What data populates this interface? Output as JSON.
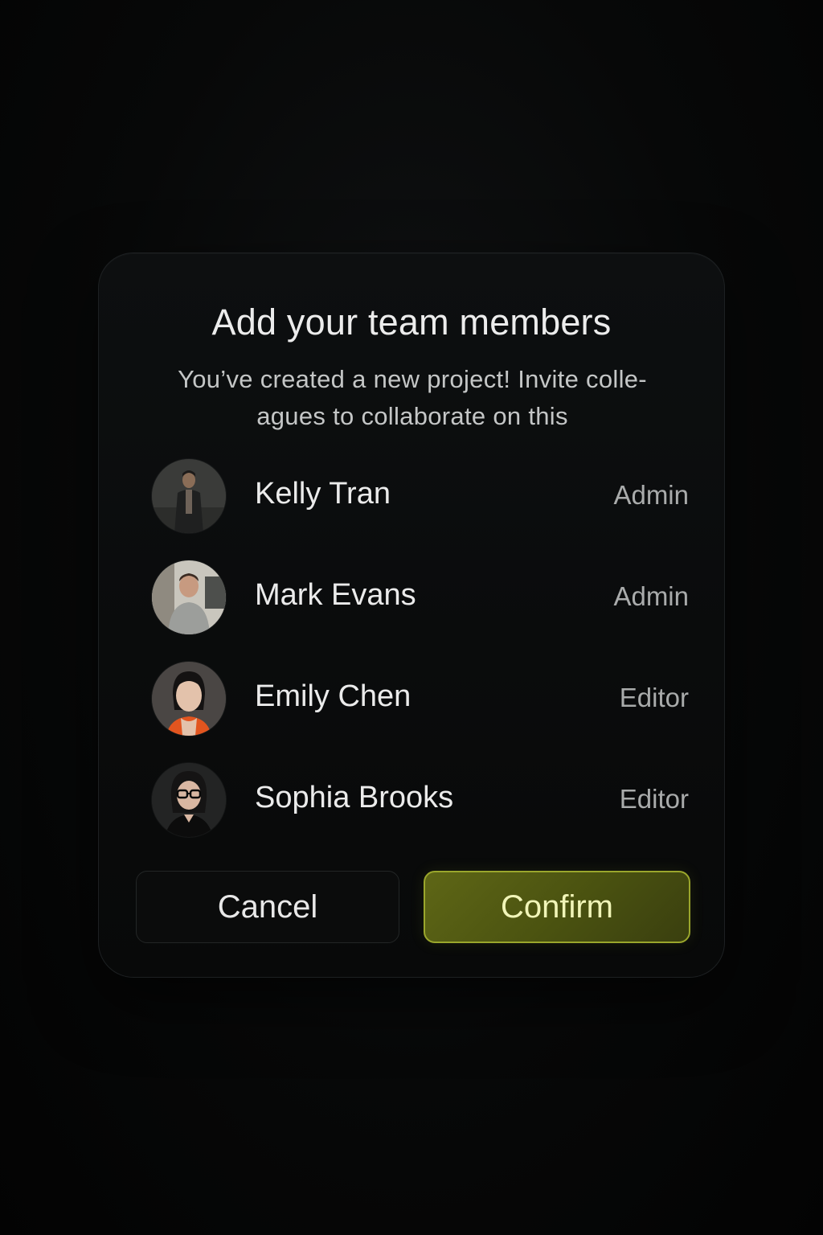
{
  "dialog": {
    "title": "Add your team members",
    "subtitle_line1": "You’ve created a new project! Invite colle-",
    "subtitle_line2": "agues to collaborate on this"
  },
  "members": [
    {
      "name": "Kelly Tran",
      "role": "Admin"
    },
    {
      "name": "Mark Evans",
      "role": "Admin"
    },
    {
      "name": "Emily Chen",
      "role": "Editor"
    },
    {
      "name": "Sophia Brooks",
      "role": "Editor"
    }
  ],
  "actions": {
    "cancel_label": "Cancel",
    "confirm_label": "Confirm"
  },
  "colors": {
    "background": "#050606",
    "dialog": "#0b0d0d",
    "confirm_fill": "#4f5712",
    "confirm_border": "#9aa62c",
    "confirm_text": "#f1f5b8"
  }
}
